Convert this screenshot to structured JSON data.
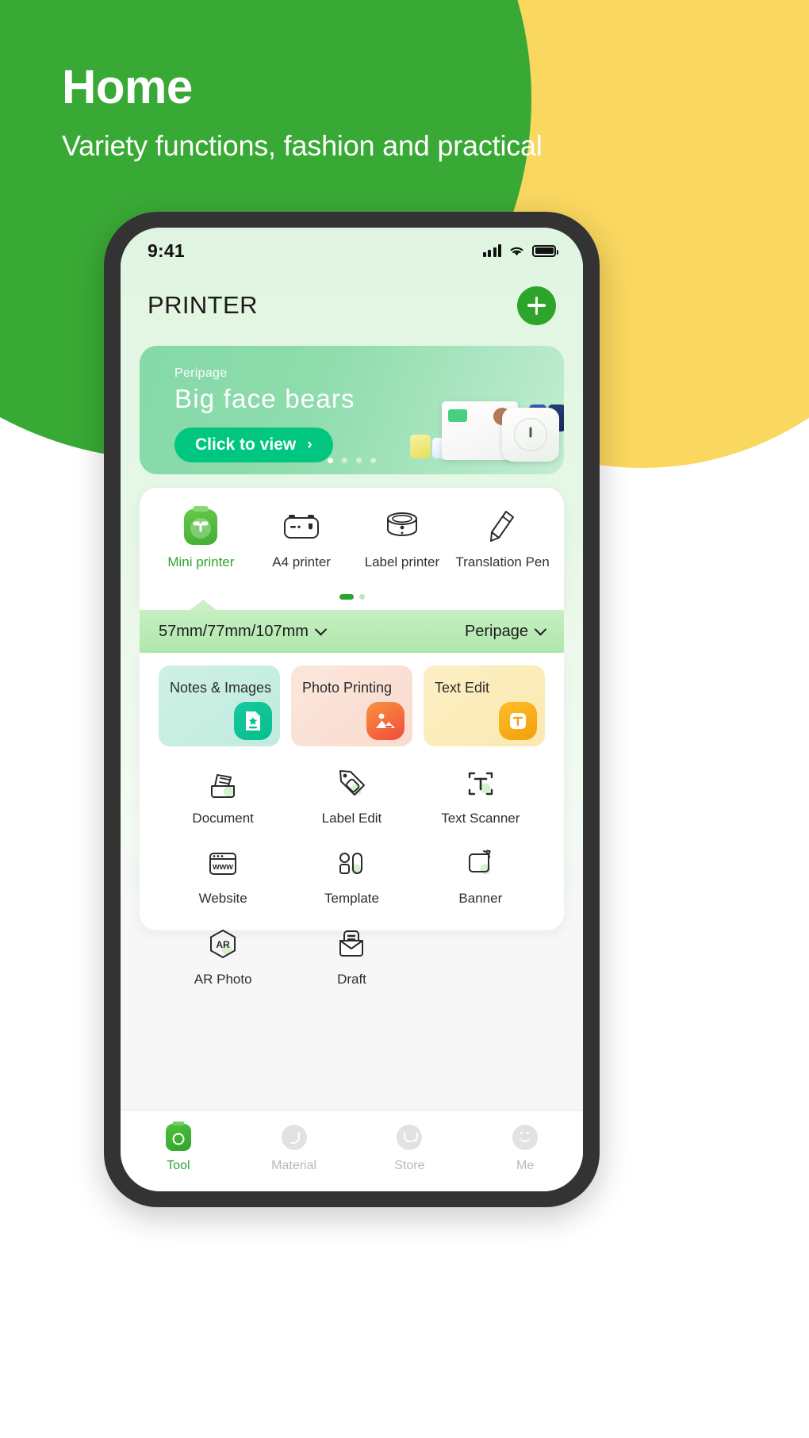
{
  "hero": {
    "title": "Home",
    "subtitle": "Variety functions, fashion and practical",
    "green": "#39A935",
    "yellow": "#FAD75F"
  },
  "status_bar": {
    "time": "9:41",
    "signal_icon": "cellular-bars-icon",
    "wifi_icon": "wifi-icon",
    "battery_icon": "battery-full-icon"
  },
  "app_header": {
    "title": "PRINTER",
    "add_button_label": "+",
    "add_button_icon": "plus-icon",
    "accent": "#2DA52B"
  },
  "promo": {
    "brand": "Peripage",
    "title": "Big face bears",
    "cta_label": "Click to view",
    "cta_chevron": "›",
    "dots_total": 4,
    "dots_active_index": 0,
    "cta_color": "#00C67F"
  },
  "printer_types": {
    "items": [
      {
        "label": "Mini printer",
        "icon": "mini-printer-icon",
        "active": true
      },
      {
        "label": "A4 printer",
        "icon": "a4-printer-icon",
        "active": false
      },
      {
        "label": "Label printer",
        "icon": "label-printer-icon",
        "active": false
      },
      {
        "label": "Translation Pen",
        "icon": "translation-pen-icon",
        "active": false
      }
    ],
    "pager_active_index": 0,
    "pager_total": 2,
    "active_color": "#2DA52B"
  },
  "size_bar": {
    "paper_size": "57mm/77mm/107mm",
    "paper_size_caret": "chevron-down-icon",
    "brand": "Peripage",
    "brand_caret": "chevron-down-icon"
  },
  "feature_cards": [
    {
      "title": "Notes & Images",
      "icon": "note-star-icon",
      "color": "#06BE8C"
    },
    {
      "title": "Photo Printing",
      "icon": "photo-image-icon",
      "color": "#F24A3C"
    },
    {
      "title": "Text Edit",
      "icon": "text-edit-icon",
      "color": "#F59E0B"
    }
  ],
  "tool_grid": [
    {
      "label": "Document",
      "icon": "document-icon"
    },
    {
      "label": "Label Edit",
      "icon": "label-tag-icon"
    },
    {
      "label": "Text Scanner",
      "icon": "text-scanner-icon"
    },
    {
      "label": "Website",
      "icon": "website-www-icon"
    },
    {
      "label": "Template",
      "icon": "template-icon"
    },
    {
      "label": "Banner",
      "icon": "banner-icon"
    },
    {
      "label": "AR Photo",
      "icon": "ar-photo-icon"
    },
    {
      "label": "Draft",
      "icon": "draft-icon"
    }
  ],
  "tab_bar": {
    "items": [
      {
        "label": "Tool",
        "icon": "tool-printer-icon",
        "active": true
      },
      {
        "label": "Material",
        "icon": "material-moon-icon",
        "active": false
      },
      {
        "label": "Store",
        "icon": "store-bag-icon",
        "active": false
      },
      {
        "label": "Me",
        "icon": "me-face-icon",
        "active": false
      }
    ],
    "active_color": "#2DA52B",
    "inactive_color": "#B9B9B9"
  }
}
